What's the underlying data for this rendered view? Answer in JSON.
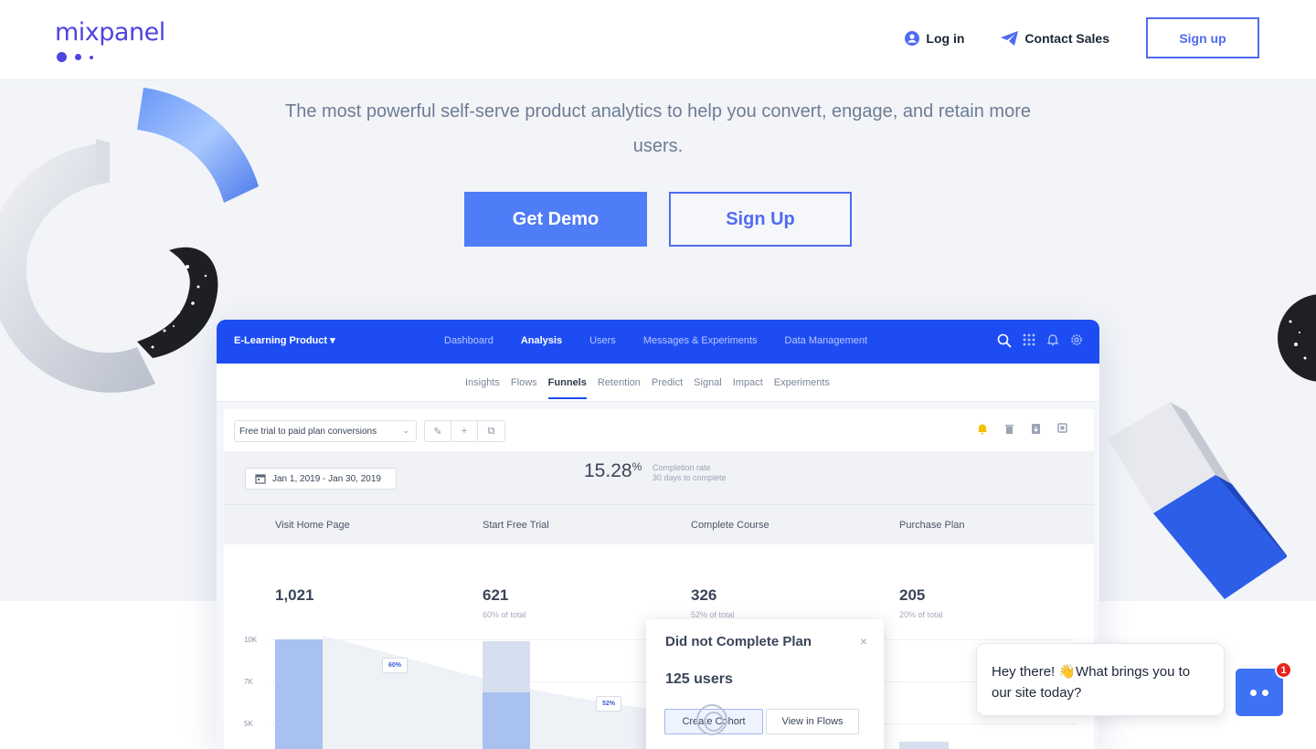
{
  "nav": {
    "logo": "mixpanel",
    "login": "Log in",
    "contact": "Contact Sales",
    "signup": "Sign up"
  },
  "hero": {
    "tagline": "The most powerful self-serve product analytics to help you convert, engage, and retain more users.",
    "cta_demo": "Get Demo",
    "cta_signup": "Sign Up"
  },
  "app": {
    "product": "E-Learning Product ▾",
    "menu": [
      "Dashboard",
      "Analysis",
      "Users",
      "Messages & Experiments",
      "Data Management"
    ],
    "active_menu": "Analysis",
    "subnav": [
      "Insights",
      "Flows",
      "Funnels",
      "Retention",
      "Predict",
      "Signal",
      "Impact",
      "Experiments"
    ],
    "active_subnav": "Funnels",
    "report_name": "Free trial to paid plan conversions",
    "date_range": "Jan 1, 2019 - Jan 30, 2019",
    "completion_rate": "15.28",
    "completion_unit": "%",
    "completion_label": "Completion rate",
    "completion_sub": "30 days to complete",
    "steps": [
      {
        "name": "Visit Home Page",
        "count": "1,021",
        "pct": ""
      },
      {
        "name": "Start Free Trial",
        "count": "621",
        "pct": "60% of total"
      },
      {
        "name": "Complete Course",
        "count": "326",
        "pct": "52% of total"
      },
      {
        "name": "Purchase Plan",
        "count": "205",
        "pct": "20% of total"
      }
    ],
    "y_axis": [
      "10K",
      "7K",
      "5K"
    ],
    "conversions": [
      "60%",
      "52%"
    ]
  },
  "popover": {
    "title": "Did not Complete Plan",
    "close": "×",
    "users": "125 users",
    "btn_cohort": "Create Cohort",
    "btn_flows": "View in Flows"
  },
  "chat": {
    "message": "Hey there! 👋What brings you to our site today?",
    "badge": "1"
  },
  "colors": {
    "brand": "#4f44e0",
    "primary": "#4f7cf7",
    "app_bar": "#1d4df2"
  }
}
